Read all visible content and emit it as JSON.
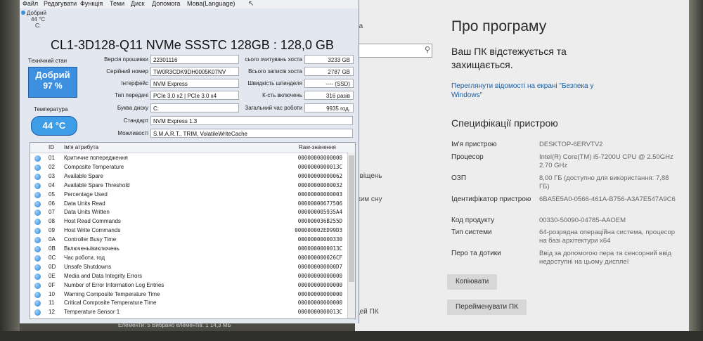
{
  "menu": [
    "Файл",
    "Редагувати",
    "Функція",
    "Теми",
    "Диск",
    "Допомога",
    "Мова(Language)"
  ],
  "health_mini": {
    "status": "Добрий",
    "temp": "44 °C",
    "drive": "C:"
  },
  "disk": {
    "title": "CL1-3D128-Q11 NVMe SSSTC 128GB : 128,0 GB"
  },
  "status_panel": {
    "health_label": "Технічний стан",
    "health_word": "Добрий",
    "health_pct": "97 %",
    "temp_label": "Температура",
    "temp": "44 °C"
  },
  "fields": {
    "firmware": {
      "label": "Версія прошивки",
      "value": "22301116"
    },
    "serial": {
      "label": "Серійний номер",
      "value": "TW0R3CDK9DH0005K07NV"
    },
    "interface": {
      "label": "Інтерфейс",
      "value": "NVM Express"
    },
    "transfer": {
      "label": "Тип передачі",
      "value": "PCIe 3.0 x2 | PCIe 3.0 x4"
    },
    "letter": {
      "label": "Буква диску",
      "value": "C:"
    },
    "standard": {
      "label": "Стандарт",
      "value": "NVM Express 1.3"
    },
    "features": {
      "label": "Можливості",
      "value": "S.M.A.R.T., TRIM, VolatileWriteCache"
    }
  },
  "right_fields": [
    {
      "label": "сього зчитувань хоста",
      "value": "3233 GB"
    },
    {
      "label": "Всього записів хоста",
      "value": "2787 GB"
    },
    {
      "label": "Швидкість шпинделя",
      "value": "---- (SSD)"
    },
    {
      "label": "К-сть включень",
      "value": "316 разів"
    },
    {
      "label": "Загальний час роботи",
      "value": "9935 год."
    }
  ],
  "smart": {
    "col_id": "ID",
    "col_name": "Ім'я атрибута",
    "col_raw": "Raw-значення",
    "rows": [
      {
        "id": "01",
        "name": "Критичне попередження",
        "raw": "00000000000000"
      },
      {
        "id": "02",
        "name": "Composite Temperature",
        "raw": "0000000000013C"
      },
      {
        "id": "03",
        "name": "Available Spare",
        "raw": "00000000000062"
      },
      {
        "id": "04",
        "name": "Available Spare Threshold",
        "raw": "00000000000032"
      },
      {
        "id": "05",
        "name": "Percentage Used",
        "raw": "00000000000003"
      },
      {
        "id": "06",
        "name": "Data Units Read",
        "raw": "00000000677506"
      },
      {
        "id": "07",
        "name": "Data Units Written",
        "raw": "000000005935A4"
      },
      {
        "id": "08",
        "name": "Host Read Commands",
        "raw": "000000036B255D"
      },
      {
        "id": "09",
        "name": "Host Write Commands",
        "raw": "000000002ED99D3"
      },
      {
        "id": "0A",
        "name": "Controller Busy Time",
        "raw": "00000000000330"
      },
      {
        "id": "0B",
        "name": "Включень/виключень",
        "raw": "0000000000013C"
      },
      {
        "id": "0C",
        "name": "Час роботи, год",
        "raw": "000000000026CF"
      },
      {
        "id": "0D",
        "name": "Unsafe Shutdowns",
        "raw": "000000000000D7"
      },
      {
        "id": "0E",
        "name": "Media and Data Integrity Errors",
        "raw": "00000000000000"
      },
      {
        "id": "0F",
        "name": "Number of Error Information Log Entries",
        "raw": "00000000000000"
      },
      {
        "id": "10",
        "name": "Warning Composite Temperature Time",
        "raw": "00000000000000"
      },
      {
        "id": "11",
        "name": "Critical Composite Temperature Time",
        "raw": "00000000000000"
      },
      {
        "id": "12",
        "name": "Temperature Sensor 1",
        "raw": "0000000000013C"
      }
    ]
  },
  "status_bar": "Елементи: 5     Вибрано елементів: 1  14,3 МБ",
  "bg_fragments": [
    "ка",
    "овіщень",
    "жим сну",
    "цей ПК"
  ],
  "settings": {
    "title": "Про програму",
    "protect_text": "Ваш ПК відстежується та захищається.",
    "security_link": "Переглянути відомості на екрані \"Безпека у Windows\"",
    "spec_title": "Специфікації пристрою",
    "specs": [
      {
        "label": "Ім'я пристрою",
        "value": "DESKTOP-6ERVTV2"
      },
      {
        "label": "Процесор",
        "value": "Intel(R) Core(TM) i5-7200U CPU @ 2.50GHz   2.70 GHz"
      },
      {
        "label": "ОЗП",
        "value": "8,00 ГБ (доступно для використання: 7,88 ГБ)"
      },
      {
        "label": "Ідентифікатор пристрою",
        "value": "6BA5E5A0-0566-461A-B756-A3A7E547A9C6"
      },
      {
        "label": "Код продукту",
        "value": "00330-50090-04785-AAOEM"
      },
      {
        "label": "Тип системи",
        "value": "64-розрядна операційна система, процесор на базі архітектури x64"
      },
      {
        "label": "Перо та дотики",
        "value": "Ввід за допомогою пера та сенсорний ввід недоступні на цьому дисплеї"
      }
    ],
    "copy_button": "Копіювати",
    "rename_button": "Перейменувати ПК"
  }
}
